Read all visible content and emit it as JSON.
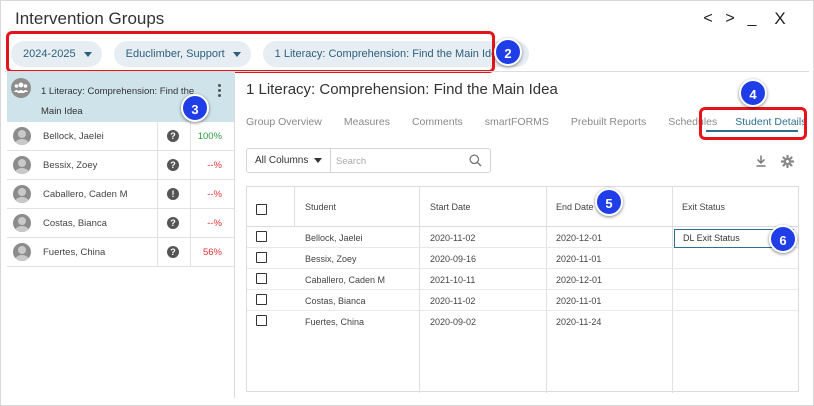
{
  "window": {
    "title": "Intervention Groups",
    "controls": [
      "<",
      ">",
      "_",
      "X"
    ]
  },
  "filters": {
    "year": "2024-2025",
    "group_type": "Educlimber, Support",
    "group": "1 Literacy: Comprehension: Find the Main Idea"
  },
  "left_panel": {
    "group_name": "1 Literacy: Comprehension: Find the Main Idea",
    "students": [
      {
        "name": "Bellock, Jaelei",
        "status_icon": "?",
        "percent": "100%",
        "percent_color": "#2e9e3a"
      },
      {
        "name": "Bessix, Zoey",
        "status_icon": "?",
        "percent": "--%",
        "percent_color": "#e03232"
      },
      {
        "name": "Caballero, Caden M",
        "status_icon": "!",
        "percent": "--%",
        "percent_color": "#e03232"
      },
      {
        "name": "Costas, Bianca",
        "status_icon": "?",
        "percent": "--%",
        "percent_color": "#e03232"
      },
      {
        "name": "Fuertes, China",
        "status_icon": "?",
        "percent": "56%",
        "percent_color": "#e03232"
      }
    ]
  },
  "main": {
    "title": "1 Literacy: Comprehension: Find the Main Idea",
    "tabs": [
      "Group Overview",
      "Measures",
      "Comments",
      "smartFORMS",
      "Prebuilt Reports",
      "Schedules",
      "Student Details"
    ],
    "active_tab": "Student Details",
    "column_select": "All Columns",
    "search_placeholder": "Search",
    "table": {
      "headers": [
        "Student",
        "Start Date",
        "End Date",
        "Exit Status"
      ],
      "rows": [
        {
          "student": "Bellock, Jaelei",
          "start": "2020-11-02",
          "end": "2020-12-01",
          "exit": "DL Exit Status"
        },
        {
          "student": "Bessix, Zoey",
          "start": "2020-09-16",
          "end": "2020-11-01",
          "exit": ""
        },
        {
          "student": "Caballero, Caden M",
          "start": "2021-10-11",
          "end": "2020-12-01",
          "exit": ""
        },
        {
          "student": "Costas, Bianca",
          "start": "2020-11-02",
          "end": "2020-11-01",
          "exit": ""
        },
        {
          "student": "Fuertes, China",
          "start": "2020-09-02",
          "end": "2020-11-24",
          "exit": ""
        }
      ]
    }
  },
  "callouts": [
    "2",
    "3",
    "4",
    "5",
    "6"
  ],
  "colors": {
    "accent": "#2d6f93",
    "callout_blue": "#1f3ee8",
    "highlight_red": "#e5141a",
    "group_header_bg": "#cfe3ea",
    "pill_bg": "#e7eef3"
  }
}
